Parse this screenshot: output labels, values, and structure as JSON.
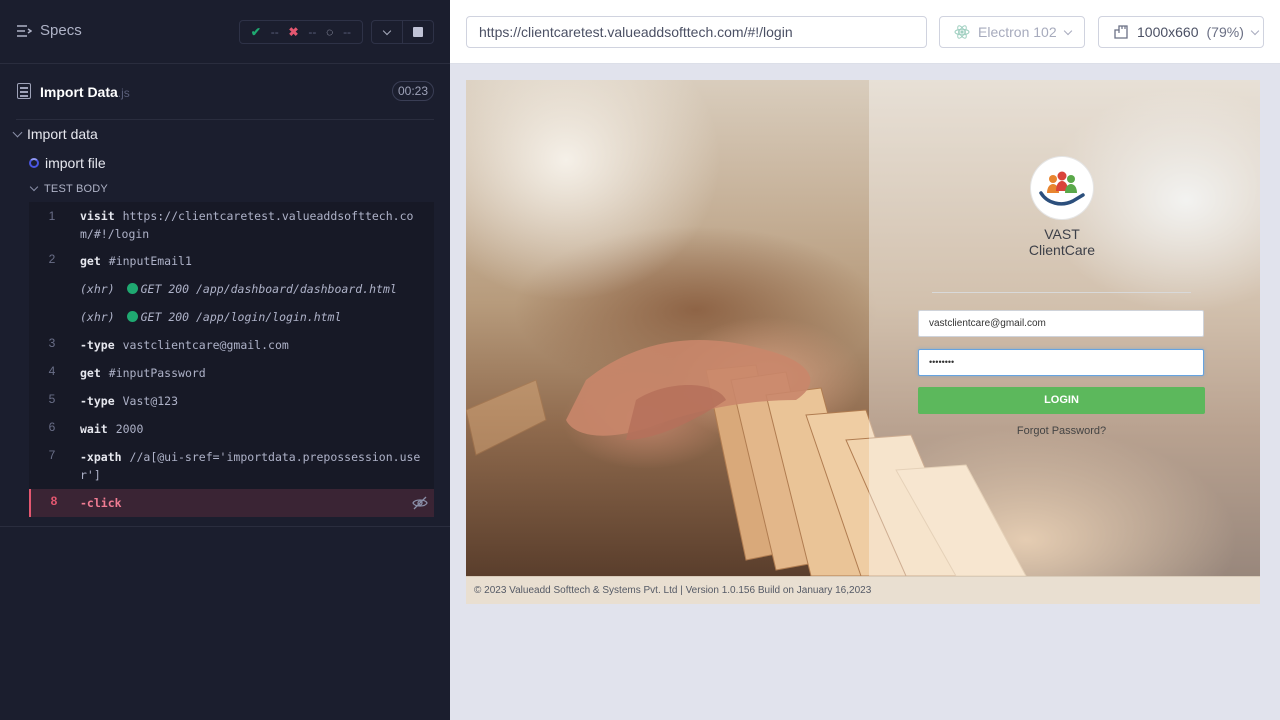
{
  "reporter": {
    "specs_label": "Specs",
    "stats": {
      "passed": "--",
      "failed": "--",
      "pending": "--"
    },
    "spec": {
      "title": "Import Data",
      "ext": ".js",
      "duration": "00:23"
    },
    "suite": {
      "title": "Import data"
    },
    "test": {
      "title": "import file"
    },
    "section": "TEST BODY",
    "commands": [
      {
        "num": "1",
        "name": "visit",
        "message": "https://clientcaretest.valueaddsofttech.com/#!/login"
      },
      {
        "num": "2",
        "name": "get",
        "message": "#inputEmail1"
      },
      {
        "num": "",
        "name": "(xhr)",
        "message": "GET 200 /app/dashboard/dashboard.html"
      },
      {
        "num": "",
        "name": "(xhr)",
        "message": "GET 200 /app/login/login.html"
      },
      {
        "num": "3",
        "name": "-type",
        "message": "vastclientcare@gmail.com"
      },
      {
        "num": "4",
        "name": "get",
        "message": "#inputPassword"
      },
      {
        "num": "5",
        "name": "-type",
        "message": "Vast@123"
      },
      {
        "num": "6",
        "name": "wait",
        "message": "2000"
      },
      {
        "num": "7",
        "name": "-xpath",
        "message": "//a[@ui-sref='importdata.prepossession.user']"
      },
      {
        "num": "8",
        "name": "-click",
        "message": ""
      }
    ]
  },
  "aut": {
    "url": "https://clientcaretest.valueaddsofttech.com/#!/login",
    "browser": "Electron 102",
    "viewport": "1000x660",
    "zoom": "(79%)",
    "app": {
      "brand_line1": "VAST",
      "brand_line2": "ClientCare",
      "email_value": "vastclientcare@gmail.com",
      "password_value": "••••••••",
      "login_label": "LOGIN",
      "forgot_label": "Forgot Password?",
      "footer": "© 2023 Valueadd Softtech & Systems Pvt. Ltd | Version 1.0.156 Build on January 16,2023"
    }
  },
  "colors": {
    "accent_green": "#1fa971",
    "fail_red": "#e45770",
    "login_green": "#5cb85c",
    "panel_bg": "#1b1e2e"
  }
}
